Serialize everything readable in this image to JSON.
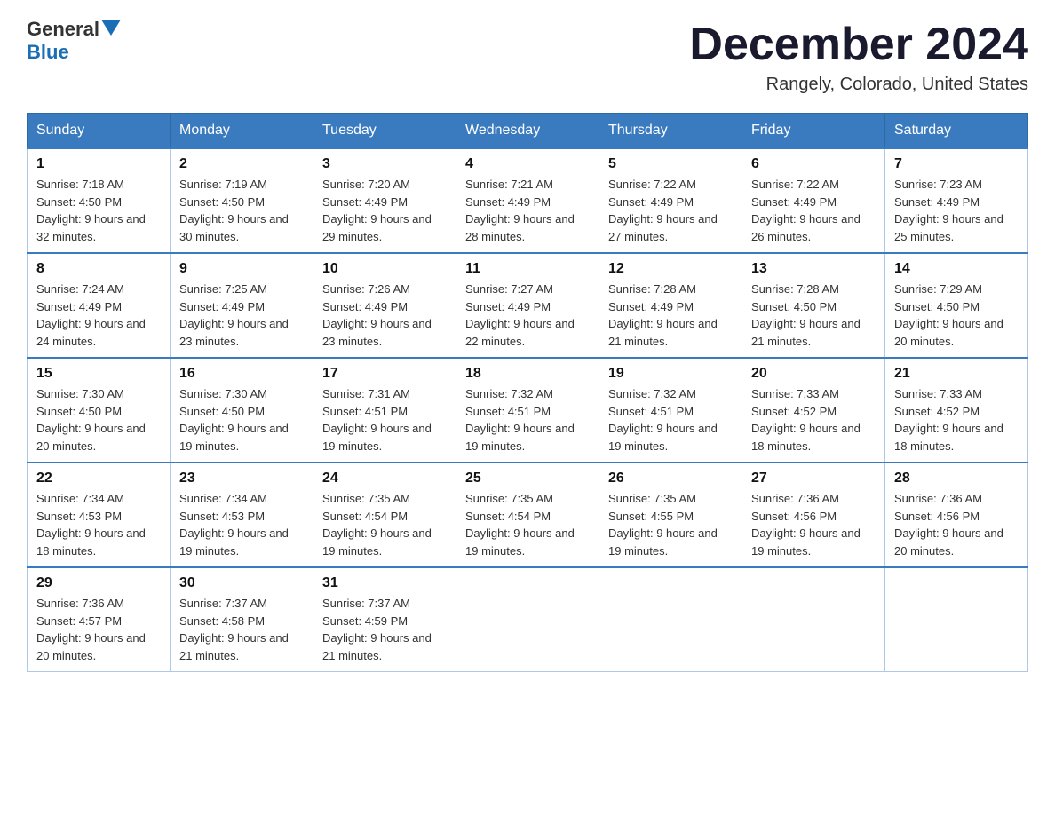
{
  "logo": {
    "general": "General",
    "blue": "Blue",
    "arrow_color": "#1a6eb5"
  },
  "title": {
    "month_year": "December 2024",
    "location": "Rangely, Colorado, United States"
  },
  "days_of_week": [
    "Sunday",
    "Monday",
    "Tuesday",
    "Wednesday",
    "Thursday",
    "Friday",
    "Saturday"
  ],
  "weeks": [
    [
      {
        "day": "1",
        "sunrise": "7:18 AM",
        "sunset": "4:50 PM",
        "daylight": "9 hours and 32 minutes."
      },
      {
        "day": "2",
        "sunrise": "7:19 AM",
        "sunset": "4:50 PM",
        "daylight": "9 hours and 30 minutes."
      },
      {
        "day": "3",
        "sunrise": "7:20 AM",
        "sunset": "4:49 PM",
        "daylight": "9 hours and 29 minutes."
      },
      {
        "day": "4",
        "sunrise": "7:21 AM",
        "sunset": "4:49 PM",
        "daylight": "9 hours and 28 minutes."
      },
      {
        "day": "5",
        "sunrise": "7:22 AM",
        "sunset": "4:49 PM",
        "daylight": "9 hours and 27 minutes."
      },
      {
        "day": "6",
        "sunrise": "7:22 AM",
        "sunset": "4:49 PM",
        "daylight": "9 hours and 26 minutes."
      },
      {
        "day": "7",
        "sunrise": "7:23 AM",
        "sunset": "4:49 PM",
        "daylight": "9 hours and 25 minutes."
      }
    ],
    [
      {
        "day": "8",
        "sunrise": "7:24 AM",
        "sunset": "4:49 PM",
        "daylight": "9 hours and 24 minutes."
      },
      {
        "day": "9",
        "sunrise": "7:25 AM",
        "sunset": "4:49 PM",
        "daylight": "9 hours and 23 minutes."
      },
      {
        "day": "10",
        "sunrise": "7:26 AM",
        "sunset": "4:49 PM",
        "daylight": "9 hours and 23 minutes."
      },
      {
        "day": "11",
        "sunrise": "7:27 AM",
        "sunset": "4:49 PM",
        "daylight": "9 hours and 22 minutes."
      },
      {
        "day": "12",
        "sunrise": "7:28 AM",
        "sunset": "4:49 PM",
        "daylight": "9 hours and 21 minutes."
      },
      {
        "day": "13",
        "sunrise": "7:28 AM",
        "sunset": "4:50 PM",
        "daylight": "9 hours and 21 minutes."
      },
      {
        "day": "14",
        "sunrise": "7:29 AM",
        "sunset": "4:50 PM",
        "daylight": "9 hours and 20 minutes."
      }
    ],
    [
      {
        "day": "15",
        "sunrise": "7:30 AM",
        "sunset": "4:50 PM",
        "daylight": "9 hours and 20 minutes."
      },
      {
        "day": "16",
        "sunrise": "7:30 AM",
        "sunset": "4:50 PM",
        "daylight": "9 hours and 19 minutes."
      },
      {
        "day": "17",
        "sunrise": "7:31 AM",
        "sunset": "4:51 PM",
        "daylight": "9 hours and 19 minutes."
      },
      {
        "day": "18",
        "sunrise": "7:32 AM",
        "sunset": "4:51 PM",
        "daylight": "9 hours and 19 minutes."
      },
      {
        "day": "19",
        "sunrise": "7:32 AM",
        "sunset": "4:51 PM",
        "daylight": "9 hours and 19 minutes."
      },
      {
        "day": "20",
        "sunrise": "7:33 AM",
        "sunset": "4:52 PM",
        "daylight": "9 hours and 18 minutes."
      },
      {
        "day": "21",
        "sunrise": "7:33 AM",
        "sunset": "4:52 PM",
        "daylight": "9 hours and 18 minutes."
      }
    ],
    [
      {
        "day": "22",
        "sunrise": "7:34 AM",
        "sunset": "4:53 PM",
        "daylight": "9 hours and 18 minutes."
      },
      {
        "day": "23",
        "sunrise": "7:34 AM",
        "sunset": "4:53 PM",
        "daylight": "9 hours and 19 minutes."
      },
      {
        "day": "24",
        "sunrise": "7:35 AM",
        "sunset": "4:54 PM",
        "daylight": "9 hours and 19 minutes."
      },
      {
        "day": "25",
        "sunrise": "7:35 AM",
        "sunset": "4:54 PM",
        "daylight": "9 hours and 19 minutes."
      },
      {
        "day": "26",
        "sunrise": "7:35 AM",
        "sunset": "4:55 PM",
        "daylight": "9 hours and 19 minutes."
      },
      {
        "day": "27",
        "sunrise": "7:36 AM",
        "sunset": "4:56 PM",
        "daylight": "9 hours and 19 minutes."
      },
      {
        "day": "28",
        "sunrise": "7:36 AM",
        "sunset": "4:56 PM",
        "daylight": "9 hours and 20 minutes."
      }
    ],
    [
      {
        "day": "29",
        "sunrise": "7:36 AM",
        "sunset": "4:57 PM",
        "daylight": "9 hours and 20 minutes."
      },
      {
        "day": "30",
        "sunrise": "7:37 AM",
        "sunset": "4:58 PM",
        "daylight": "9 hours and 21 minutes."
      },
      {
        "day": "31",
        "sunrise": "7:37 AM",
        "sunset": "4:59 PM",
        "daylight": "9 hours and 21 minutes."
      },
      null,
      null,
      null,
      null
    ]
  ],
  "labels": {
    "sunrise": "Sunrise:",
    "sunset": "Sunset:",
    "daylight": "Daylight:"
  }
}
